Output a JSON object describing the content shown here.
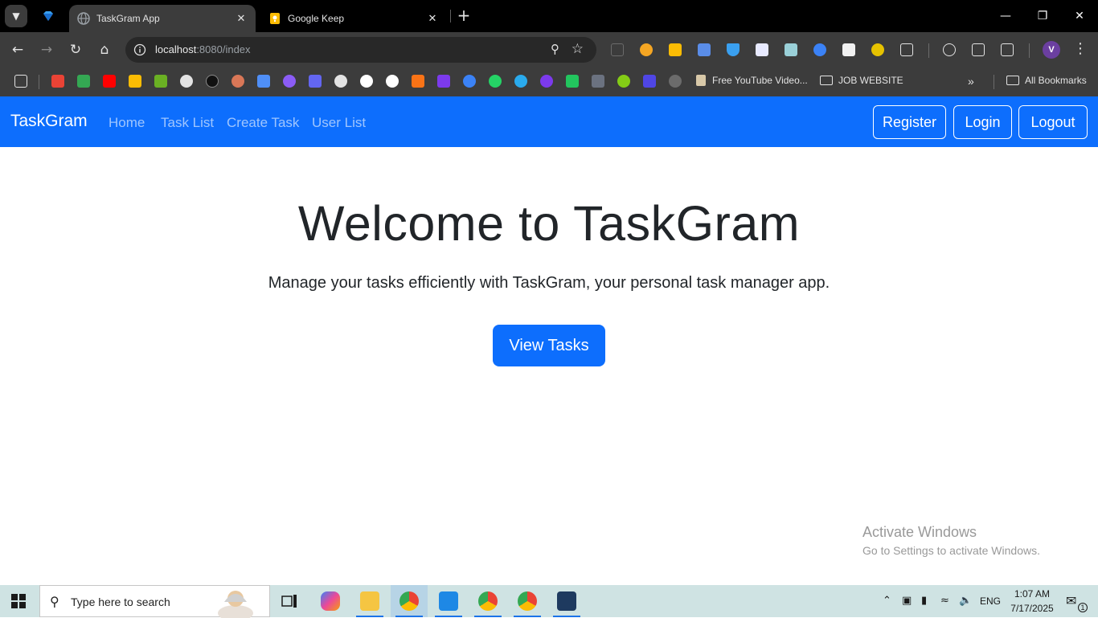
{
  "browser": {
    "tabs": [
      {
        "title": "TaskGram App",
        "active": true
      },
      {
        "title": "Google Keep",
        "active": false
      }
    ],
    "url": {
      "host": "localhost",
      "path": ":8080/index"
    },
    "bookmarks": {
      "youtube_label": "Free YouTube Video...",
      "folder_label": "JOB WEBSITE",
      "all_bookmarks_label": "All Bookmarks"
    },
    "profile_initial": "V"
  },
  "app": {
    "brand": "TaskGram",
    "nav_links": [
      "Home",
      "Task List",
      "Create Task",
      "User List"
    ],
    "auth_buttons": [
      "Register",
      "Login",
      "Logout"
    ],
    "hero": {
      "title": "Welcome to TaskGram",
      "lead": "Manage your tasks efficiently with TaskGram, your personal task manager app.",
      "cta": "View Tasks"
    },
    "accent_color": "#0d6efd"
  },
  "watermark": {
    "line1": "Activate Windows",
    "line2": "Go to Settings to activate Windows."
  },
  "taskbar": {
    "search_placeholder": "Type here to search",
    "language": "ENG",
    "time": "1:07 AM",
    "date": "7/17/2025",
    "notification_count": "1"
  }
}
